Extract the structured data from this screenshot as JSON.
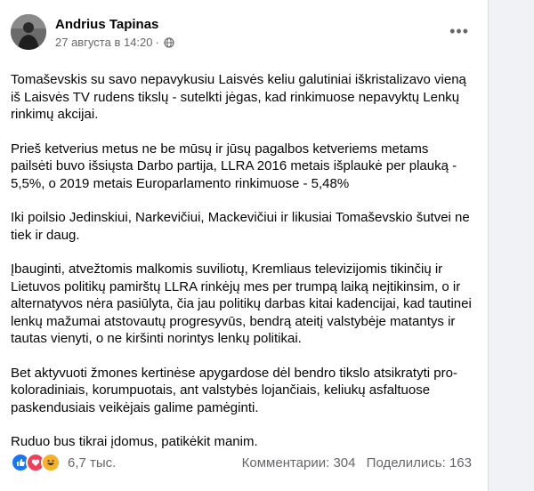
{
  "post": {
    "author": "Andrius Tapinas",
    "timestamp": "27 августа в 14:20",
    "privacy_icon": "globe-icon",
    "more_icon": "more-icon",
    "paragraphs": [
      "Tomaševskis su savo nepavykusiu Laisvės keliu galutiniai iškristalizavo vieną iš Laisvės TV rudens tikslų - sutelkti jėgas, kad rinkimuose nepavyktų Lenkų rinkimų akcijai.",
      "Prieš ketverius metus ne be mūsų ir jūsų pagalbos ketveriems metams pailsėti buvo išsiųsta Darbo partija, LLRA 2016 metais išplaukė per plauką - 5,5%, o 2019 metais Europarlamento rinkimuose - 5,48%",
      "Iki poilsio Jedinskiui, Narkevičiui, Mackevičiui ir likusiai Tomaševskio šutvei ne tiek ir daug.",
      "Įbauginti, atvežtomis malkomis suviliotų, Kremliaus televizijomis tikinčių ir Lietuvos politikų pamirštų LLRA rinkėjų mes per trumpą laiką neįtikinsim, o ir alternatyvos nėra pasiūlyta, čia jau politikų darbas kitai kadencijai, kad tautinei lenkų mažumai atstovautų progresyvūs, bendrą ateitį valstybėje matantys ir tautas vienyti, o ne kiršinti norintys lenkų politikai.",
      "Bet aktyvuoti žmones kertinėse apygardose dėl bendro tikslo atsikratyti pro-koloradiniais, korumpuotais, ant valstybės lojančiais, keliukų asfaltuose paskendusiais veikėjais galime pamėginti.",
      "Ruduo bus tikrai įdomus, patikėkit manim."
    ]
  },
  "reactions": {
    "icons": [
      "like-icon",
      "love-icon",
      "haha-icon"
    ],
    "count": "6,7 тыс.",
    "comments": "Комментарии: 304",
    "shares": "Поделились: 163"
  },
  "colors": {
    "like": "#1877f2",
    "love": "#f33e58",
    "haha": "#f7b125",
    "secondary_text": "#65676b"
  }
}
